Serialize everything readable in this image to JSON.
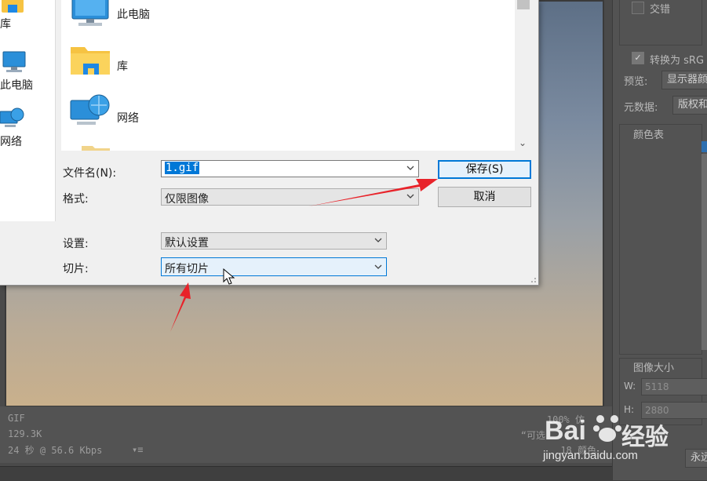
{
  "photoshop": {
    "preview_info": {
      "format": "GIF",
      "size": "129.3K",
      "time": "24 秒 @ 56.6 Kbps",
      "zoom": "100% 仿",
      "note": "“可选",
      "colors": "18 颜色"
    },
    "right_panel": {
      "interlaced_label": "交错",
      "convert_label": "转换为 sRG",
      "preview_label": "预览:",
      "preview_value": "显示器颜",
      "metadata_label": "元数据:",
      "metadata_value": "版权和",
      "color_table_label": "颜色表",
      "image_size_label": "图像大小",
      "w_label": "W:",
      "w_value": "5118",
      "h_label": "H:",
      "h_value": "2880",
      "loop_value": "永远"
    }
  },
  "dialog": {
    "nav_items": [
      {
        "label": "库"
      },
      {
        "label": "此电脑"
      },
      {
        "label": "网络"
      }
    ],
    "files": [
      {
        "label": "此电脑"
      },
      {
        "label": "库"
      },
      {
        "label": "网络"
      }
    ],
    "filename_label": "文件名(N):",
    "filename_value": "1.gif",
    "format_label": "格式:",
    "format_value": "仅限图像",
    "settings_label": "设置:",
    "settings_value": "默认设置",
    "slices_label": "切片:",
    "slices_value": "所有切片",
    "save_button": "保存(S)",
    "cancel_button": "取消"
  },
  "watermark": {
    "brand_left": "Bai",
    "brand_right": "经验",
    "url": "jingyan.baidu.com"
  },
  "colors": {
    "accent": "#0078d7",
    "arrow": "#e8232a"
  }
}
